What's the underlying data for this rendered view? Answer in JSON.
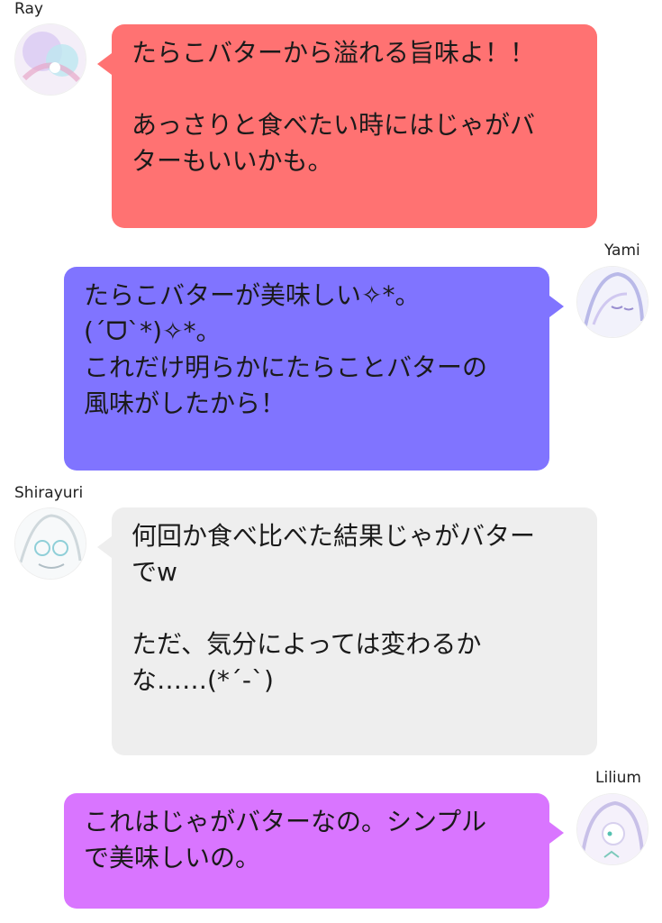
{
  "messages": [
    {
      "sender": "Ray",
      "side": "left",
      "color": "#FF7272",
      "lines": [
        "たらこバターから溢れる旨味よ！！",
        "",
        "あっさりと食べたい時にはじゃがバ",
        "ターもいいかも。"
      ]
    },
    {
      "sender": "Yami",
      "side": "right",
      "color": "#8074FF",
      "lines": [
        "たらこバターが美味しい✧*。",
        "(´ᗜ`*)✧*。",
        "これだけ明らかにたらことバターの",
        "風味がしたから！"
      ]
    },
    {
      "sender": "Shirayuri",
      "side": "left",
      "color": "#EEEEEE",
      "lines": [
        "何回か食べ比べた結果じゃがバター",
        "でw",
        "",
        "ただ、気分によっては変わるか",
        "な……(*´-`)"
      ]
    },
    {
      "sender": "Lilium",
      "side": "right",
      "color": "#D975FF",
      "lines": [
        "これはじゃがバターなの。シンプル",
        "で美味しいの。"
      ]
    }
  ]
}
